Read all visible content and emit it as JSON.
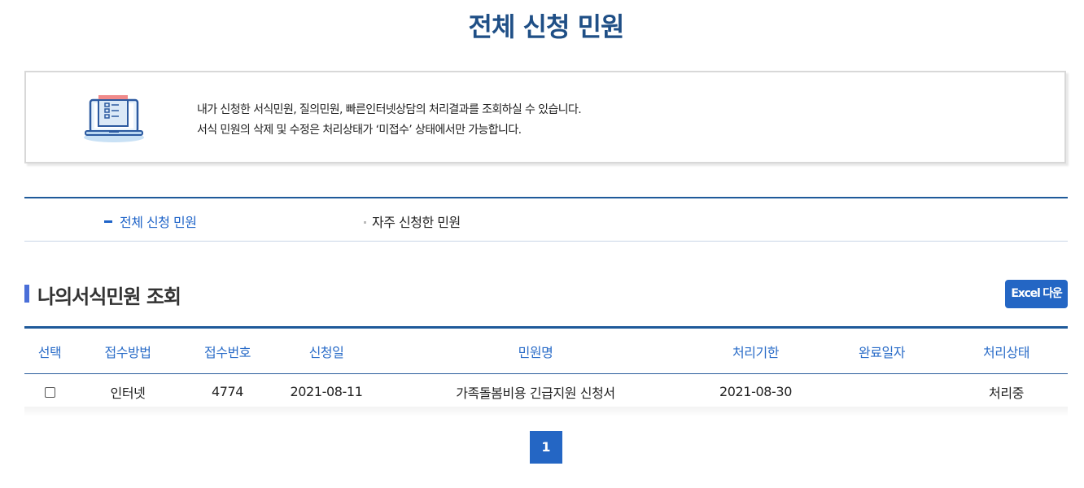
{
  "page": {
    "title": "전체 신청 민원"
  },
  "info": {
    "icon": "laptop-document-icon",
    "line1": "내가 신청한 서식민원, 질의민원, 빠른인터넷상담의 처리결과를 조회하실 수 있습니다.",
    "line2": "서식 민원의 삭제 및 수정은 처리상태가 ‘미접수’ 상태에서만 가능합니다."
  },
  "tabs": [
    {
      "label": "전체 신청 민원",
      "active": true
    },
    {
      "label": "자주 신청한 민원",
      "active": false
    }
  ],
  "section": {
    "title": "나의서식민원 조회",
    "excel_label": "Excel 다운"
  },
  "table": {
    "headers": [
      "선택",
      "접수방법",
      "접수번호",
      "신청일",
      "민원명",
      "처리기한",
      "완료일자",
      "처리상태"
    ],
    "rows": [
      {
        "method": "인터넷",
        "number": "4774",
        "apply_date": "2021-08-11",
        "name": "가족돌봄비용 긴급지원 신청서",
        "due_date": "2021-08-30",
        "complete_date": "",
        "status": "처리중"
      }
    ]
  },
  "pagination": {
    "current": "1"
  },
  "colors": {
    "accent": "#2466c4",
    "title": "#1f4f86",
    "table_border": "#1f5a9a"
  }
}
